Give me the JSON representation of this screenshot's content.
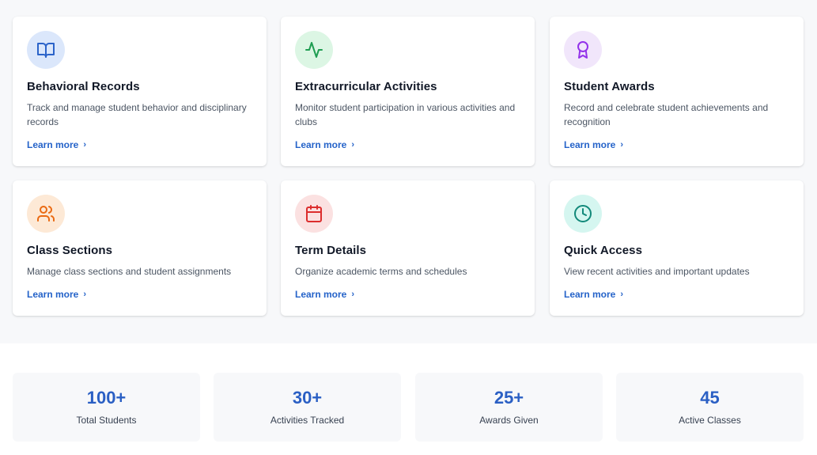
{
  "features": [
    {
      "title": "Behavioral Records",
      "description": "Track and manage student behavior and disciplinary records",
      "link": "Learn more",
      "icon": "book-open-icon",
      "icon_bg": "#dbe7fb",
      "icon_color": "#2b63c9"
    },
    {
      "title": "Extracurricular Activities",
      "description": "Monitor student participation in various activities and clubs",
      "link": "Learn more",
      "icon": "activity-pulse-icon",
      "icon_bg": "#dcf6e4",
      "icon_color": "#1f9d52"
    },
    {
      "title": "Student Awards",
      "description": "Record and celebrate student achievements and recognition",
      "link": "Learn more",
      "icon": "award-icon",
      "icon_bg": "#f1e6fb",
      "icon_color": "#9333ea"
    },
    {
      "title": "Class Sections",
      "description": "Manage class sections and student assignments",
      "link": "Learn more",
      "icon": "users-icon",
      "icon_bg": "#fde9d6",
      "icon_color": "#ea6a12"
    },
    {
      "title": "Term Details",
      "description": "Organize academic terms and schedules",
      "link": "Learn more",
      "icon": "calendar-icon",
      "icon_bg": "#fbe1e1",
      "icon_color": "#dc2d2d"
    },
    {
      "title": "Quick Access",
      "description": "View recent activities and important updates",
      "link": "Learn more",
      "icon": "clock-icon",
      "icon_bg": "#d5f6f0",
      "icon_color": "#12897a"
    }
  ],
  "stats": [
    {
      "value": "100+",
      "label": "Total Students"
    },
    {
      "value": "30+",
      "label": "Activities Tracked"
    },
    {
      "value": "25+",
      "label": "Awards Given"
    },
    {
      "value": "45",
      "label": "Active Classes"
    }
  ],
  "colors": {
    "accent": "#2563c9",
    "stat_number": "#2a5fc4",
    "section_bg": "#f7f8fa"
  }
}
